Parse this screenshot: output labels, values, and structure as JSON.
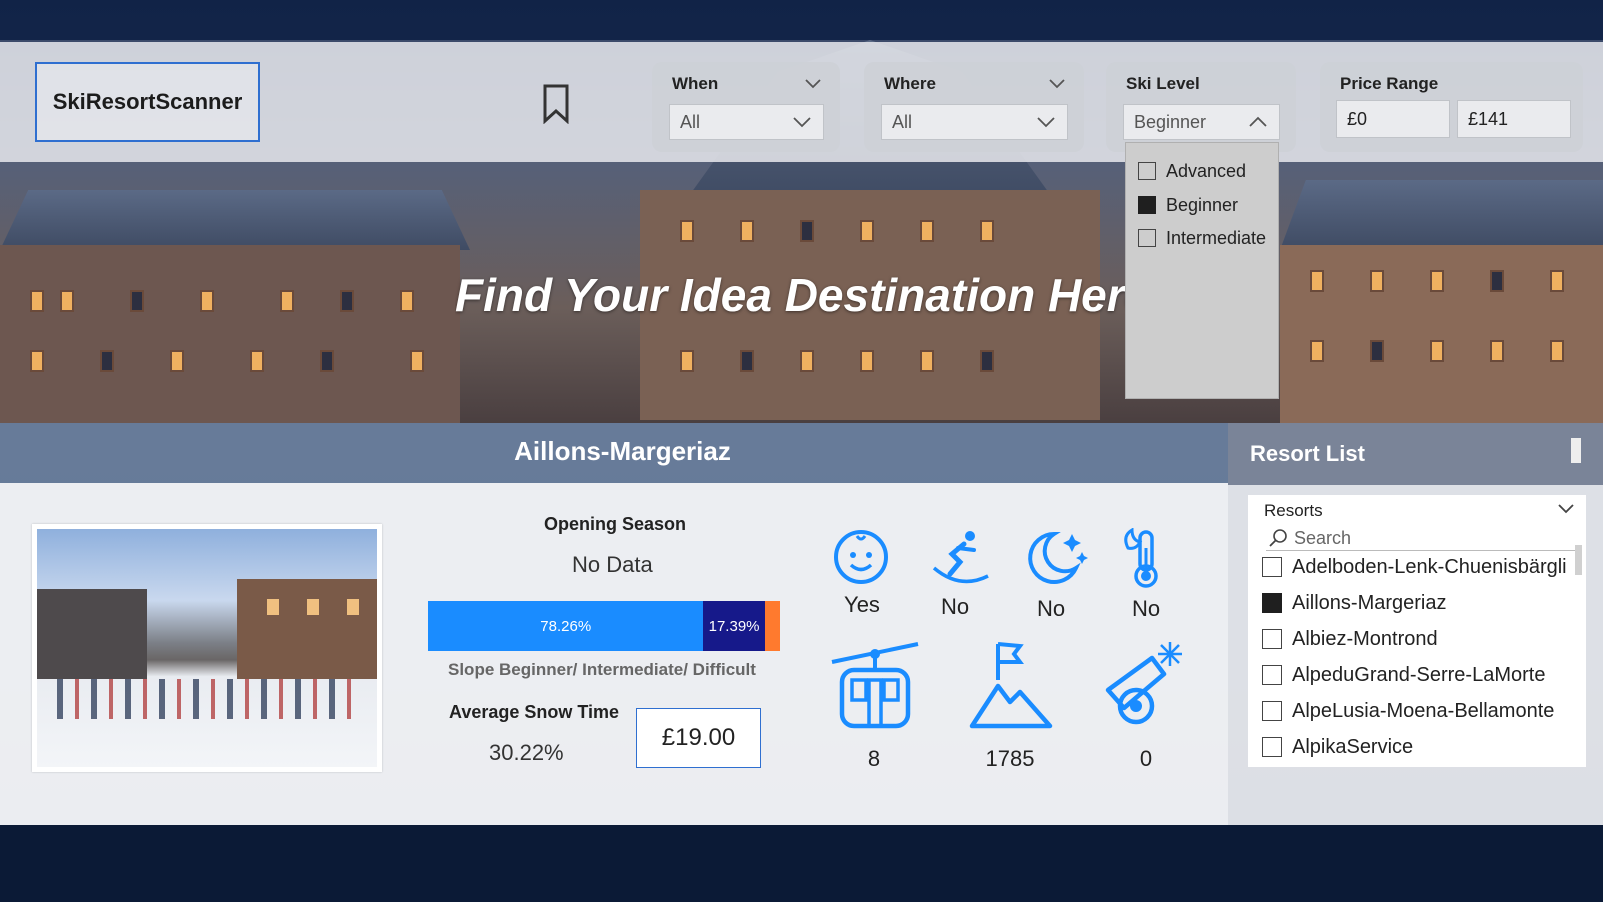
{
  "app": {
    "title": "SkiResortScanner"
  },
  "hero": {
    "tagline": "Find Your Idea Destination Here"
  },
  "filters": {
    "when": {
      "label": "When",
      "value": "All"
    },
    "where": {
      "label": "Where",
      "value": "All"
    },
    "ski_level": {
      "label": "Ski Level",
      "value": "Beginner",
      "options": [
        {
          "label": "Advanced",
          "checked": false
        },
        {
          "label": "Beginner",
          "checked": true
        },
        {
          "label": "Intermediate",
          "checked": false
        }
      ]
    },
    "price_range": {
      "label": "Price Range",
      "min": "£0",
      "max": "£141"
    }
  },
  "resort": {
    "name": "Aillons-Margeriaz",
    "opening_season_label": "Opening Season",
    "opening_season_value": "No Data",
    "slope_split": {
      "label": "Slope Beginner/ Intermediate/ Difficult",
      "beginner_pct": "78.26%",
      "intermediate_pct": "17.39%",
      "beginner_value": 78.26,
      "intermediate_value": 17.39,
      "difficult_value": 4.35
    },
    "avg_snow_label": "Average Snow Time",
    "avg_snow_value": "30.22%",
    "price": "£19.00",
    "amenities": {
      "kids": "Yes",
      "snowpark": "No",
      "night_skiing": "No",
      "summer_skiing": "No",
      "lifts": "8",
      "top_elevation": "1785",
      "snow_cannons": "0"
    }
  },
  "resort_list": {
    "title": "Resort List",
    "field_label": "Resorts",
    "search_placeholder": "Search",
    "items": [
      {
        "label": "Adelboden-Lenk-Chuenisbärgli",
        "checked": false
      },
      {
        "label": "Aillons-Margeriaz",
        "checked": true
      },
      {
        "label": "Albiez-Montrond",
        "checked": false
      },
      {
        "label": "AlpeduGrand-Serre-LaMorte",
        "checked": false
      },
      {
        "label": "AlpeLusia-Moena-Bellamonte",
        "checked": false
      },
      {
        "label": "AlpikaService",
        "checked": false
      }
    ]
  },
  "colors": {
    "accent": "#1a8cff",
    "navy": "#0f1f8a",
    "orange": "#ff7a2e",
    "icon_blue": "#1a8cff"
  }
}
